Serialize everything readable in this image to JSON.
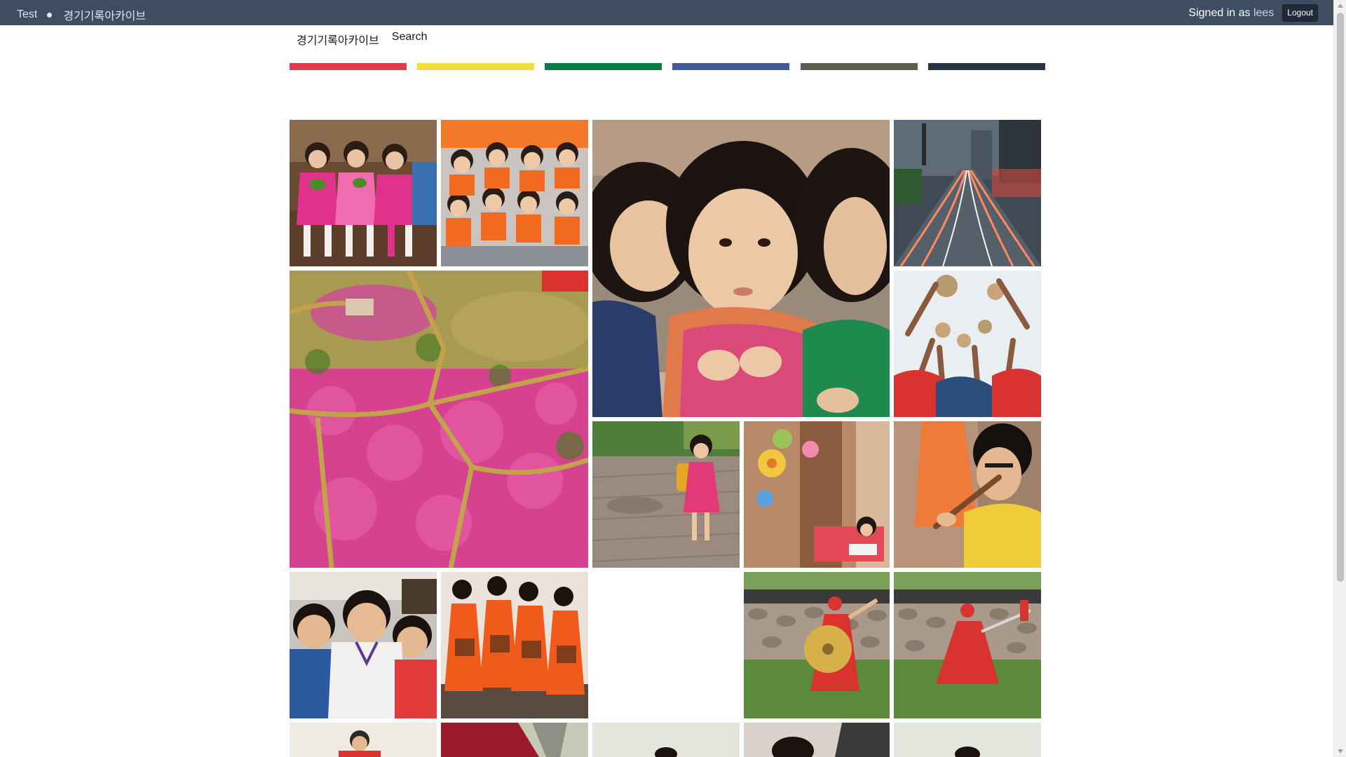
{
  "topbar": {
    "crumb_home": "Test",
    "crumb_archive": "경기기록아카이브",
    "signed_in_prefix": "Signed in as",
    "username": "lees",
    "logout_label": "Logout"
  },
  "nav": {
    "archive_label": "경기기록아카이브",
    "search_label": "Search"
  },
  "colors": {
    "topbar_bg": "#3f4d62",
    "bars": [
      "#e03c4c",
      "#f5dc3d",
      "#0a7a46",
      "#41599f",
      "#5a5e52",
      "#283445"
    ]
  },
  "gallery": {
    "tiles": [
      {
        "name": "photo-children-bench",
        "subject": "girls in pink sitting on steps"
      },
      {
        "name": "photo-kindergarten-group",
        "subject": "children in orange vests"
      },
      {
        "name": "photo-girls-closeup",
        "subject": "two girls looking sideways"
      },
      {
        "name": "photo-city-traffic-night",
        "subject": "light trails on city road"
      },
      {
        "name": "photo-azalea-hill-aerial",
        "subject": "pink azalea field aerial"
      },
      {
        "name": "photo-volleyball-hands",
        "subject": "hands reaching for balls"
      },
      {
        "name": "photo-girl-walking",
        "subject": "girl with backpack walking"
      },
      {
        "name": "photo-classroom-decor",
        "subject": "classroom wall decorations"
      },
      {
        "name": "photo-boy-flute",
        "subject": "boy playing flute"
      },
      {
        "name": "photo-three-boys",
        "subject": "three smiling boys"
      },
      {
        "name": "photo-dancers-orange",
        "subject": "women dancing in orange"
      },
      {
        "name": "photo-empty-slot",
        "subject": ""
      },
      {
        "name": "photo-martial-arts-shield",
        "subject": "performer with shield"
      },
      {
        "name": "photo-martial-arts-sword",
        "subject": "performer with sword"
      },
      {
        "name": "photo-man-red",
        "subject": ""
      },
      {
        "name": "photo-red-book",
        "subject": ""
      },
      {
        "name": "photo-person-light",
        "subject": ""
      },
      {
        "name": "photo-person-dark",
        "subject": ""
      },
      {
        "name": "photo-person-light-2",
        "subject": ""
      }
    ]
  }
}
